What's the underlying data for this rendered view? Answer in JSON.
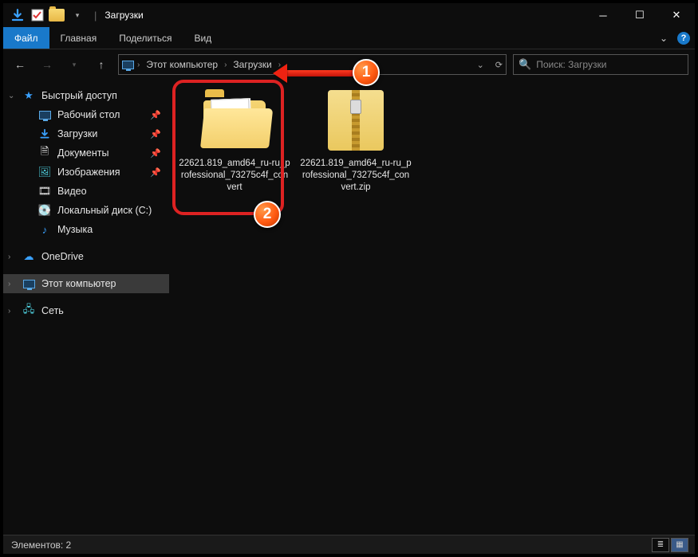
{
  "window": {
    "title": "Загрузки"
  },
  "ribbon": {
    "file": "Файл",
    "tabs": [
      "Главная",
      "Поделиться",
      "Вид"
    ]
  },
  "breadcrumb": {
    "segments": [
      "Этот компьютер",
      "Загрузки"
    ]
  },
  "search": {
    "placeholder": "Поиск: Загрузки"
  },
  "sidebar": {
    "quick_access": "Быстрый доступ",
    "items": [
      {
        "label": "Рабочий стол",
        "icon": "desktop",
        "pinned": true
      },
      {
        "label": "Загрузки",
        "icon": "download",
        "pinned": true
      },
      {
        "label": "Документы",
        "icon": "documents",
        "pinned": true
      },
      {
        "label": "Изображения",
        "icon": "pictures",
        "pinned": true
      },
      {
        "label": "Видео",
        "icon": "video",
        "pinned": false
      },
      {
        "label": "Локальный диск (C:)",
        "icon": "disk",
        "pinned": false
      },
      {
        "label": "Музыка",
        "icon": "music",
        "pinned": false
      }
    ],
    "onedrive": "OneDrive",
    "this_pc": "Этот компьютер",
    "network": "Сеть"
  },
  "files": [
    {
      "name": "22621.819_amd64_ru-ru_professional_73275c4f_convert",
      "type": "folder"
    },
    {
      "name": "22621.819_amd64_ru-ru_professional_73275c4f_convert.zip",
      "type": "zip"
    }
  ],
  "statusbar": {
    "text": "Элементов: 2"
  },
  "annotations": {
    "bubble1": "1",
    "bubble2": "2"
  }
}
